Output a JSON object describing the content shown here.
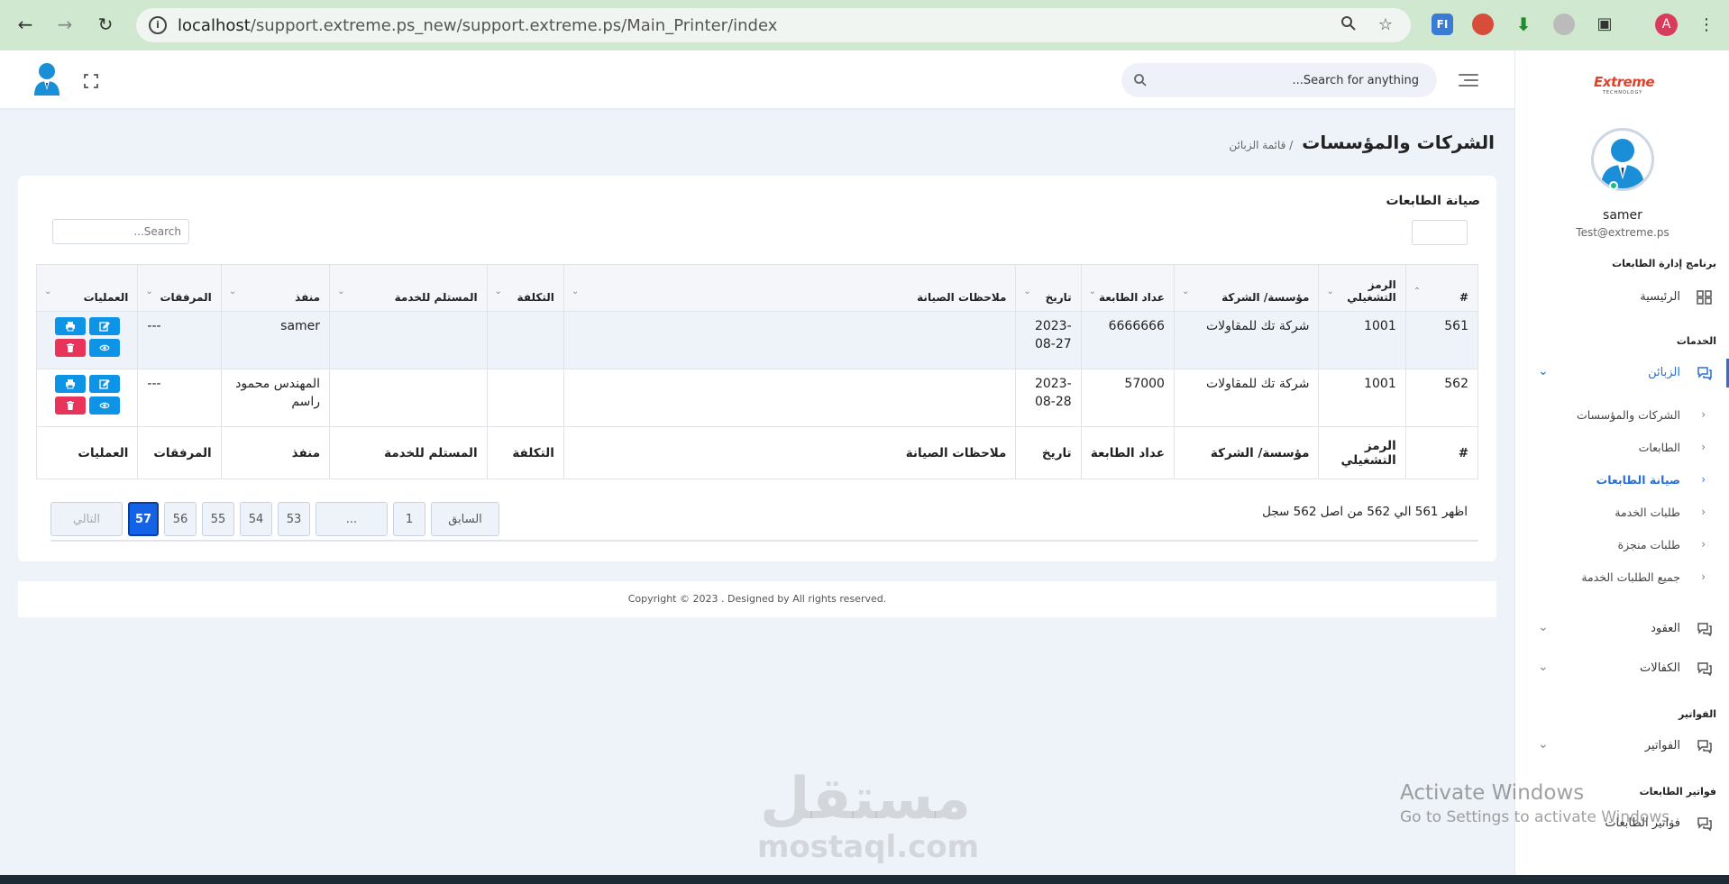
{
  "browser": {
    "url_host": "localhost",
    "url_path": "/support.extreme.ps_new/support.extreme.ps/Main_Printer/index",
    "profile_initial": "A",
    "ext_fi_label": "FI"
  },
  "header": {
    "search_placeholder": "Search for anything...",
    "colors": {
      "bg": "#ffffff",
      "accent": "#2a6fd6"
    }
  },
  "sidebar": {
    "logo_main": "Extreme",
    "logo_sub": "TECHNOLOGY",
    "username": "samer",
    "email": "Test@extreme.ps",
    "sections": {
      "program": "برنامج إدارة الطابعات",
      "services": "الخدمات",
      "invoices": "الفواتير",
      "printer_invoices": "فواتير الطابعات"
    },
    "items": {
      "home": "الرئيسية",
      "customers": "الزبائن",
      "contracts": "العقود",
      "guarantees": "الكفالات",
      "invoices": "الفواتير",
      "printer_invoices": "فواتير الطابعات"
    },
    "sub_items": [
      {
        "label": "الشركات والمؤسسات"
      },
      {
        "label": "الطابعات"
      },
      {
        "label": "صيانة الطابعات",
        "active": true
      },
      {
        "label": "طلبات الخدمة"
      },
      {
        "label": "طلبات منجزة"
      },
      {
        "label": "جميع الطلبات الخدمة"
      }
    ]
  },
  "page": {
    "title": "الشركات والمؤسسات",
    "breadcrumb": "/ قائمة الزبائن"
  },
  "card": {
    "title": "صيانة الطابعات",
    "search_placeholder": "Search...",
    "columns": [
      "#",
      "الرمز التشغيلي",
      "مؤسسة/ الشركة",
      "عداد الطابعة",
      "تاريخ",
      "ملاحظات الصيانة",
      "التكلفة",
      "المستلم للخدمة",
      "منفذ",
      "المرفقات",
      "العمليات"
    ],
    "rows": [
      {
        "num": "561",
        "code": "1001",
        "company": "شركة تك للمقاولات",
        "counter": "6666666",
        "date": "2023-08-27",
        "notes": "",
        "cost": "",
        "receiver": "",
        "executor": "samer",
        "attachments": "---"
      },
      {
        "num": "562",
        "code": "1001",
        "company": "شركة تك للمقاولات",
        "counter": "57000",
        "date": "2023-08-28",
        "notes": "",
        "cost": "",
        "receiver": "",
        "executor": "المهندس محمود راسم",
        "attachments": "---"
      }
    ],
    "info": "اظهر 561 الي 562 من اصل 562 سجل",
    "pagination": {
      "prev": "السابق",
      "next": "التالي",
      "pages": [
        "1",
        "...",
        "53",
        "54",
        "55",
        "56",
        "57"
      ],
      "current": "57"
    }
  },
  "footer": {
    "text": "Copyright © 2023 . Designed by All rights reserved."
  },
  "overlays": {
    "watermark_ar": "مستقل",
    "watermark_en": "mostaql.com",
    "activate_title": "Activate Windows",
    "activate_sub": "Go to Settings to activate Windows."
  }
}
